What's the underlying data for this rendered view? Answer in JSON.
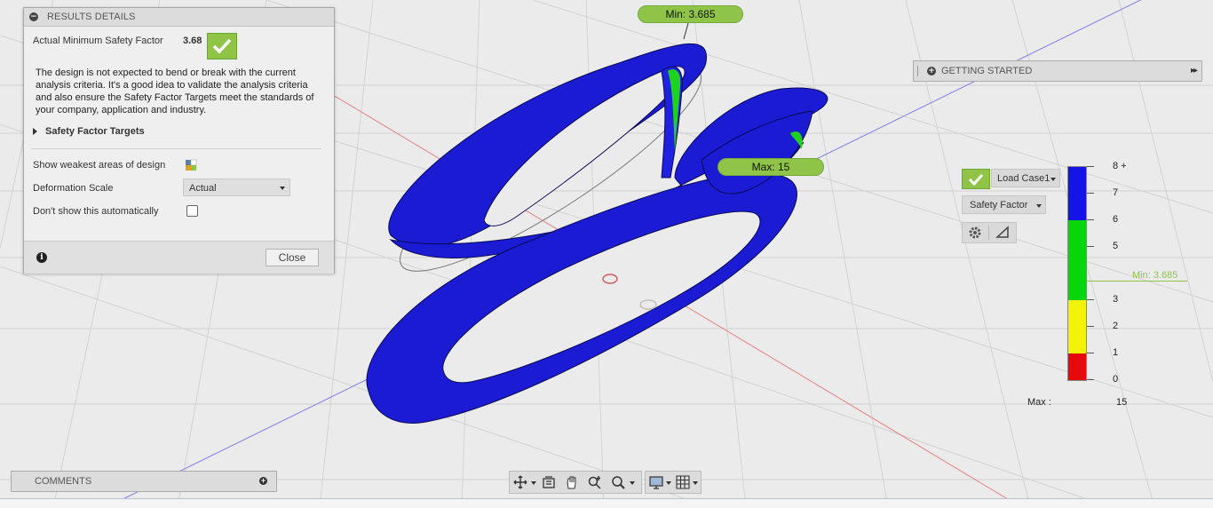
{
  "results_panel": {
    "title": "RESULTS DETAILS",
    "collapse_glyph": "−",
    "min_sf_label": "Actual Minimum Safety Factor",
    "min_sf_value": "3.68",
    "message": "The design is not expected to bend or break with the current analysis criteria. It's a good idea to validate the analysis criteria and also ensure the Safety Factor Targets meet the standards of your company, application and industry.",
    "safety_targets_label": "Safety Factor Targets",
    "show_weakest_label": "Show weakest areas of design",
    "deformation_label": "Deformation Scale",
    "deformation_value": "Actual",
    "dont_show_label": "Don't show this automatically",
    "info_glyph": "i",
    "close_label": "Close"
  },
  "getting_started": {
    "title": "GETTING STARTED",
    "plus_glyph": "+",
    "arrow_glyph": "▸▸"
  },
  "comments": {
    "title": "COMMENTS",
    "plus_glyph": "+"
  },
  "callouts": {
    "min": "Min: 3.685",
    "max": "Max: 15"
  },
  "legend": {
    "load_case": "Load Case1",
    "result_type": "Safety Factor",
    "ticks": [
      "8 +",
      "7",
      "6",
      "5",
      "3",
      "2",
      "1",
      "0"
    ],
    "min_marker": "Min: 3.685",
    "max_label": "Max :",
    "max_value": "15",
    "colors": {
      "blue": "#1414e6",
      "green": "#0ad40a",
      "yellow": "#f2f20a",
      "red": "#e60a0a"
    }
  },
  "icons": {
    "check": "check-icon",
    "gear": "gear-icon",
    "probe": "probe-icon",
    "orbit": "orbit-icon",
    "look_at": "look-at-icon",
    "pan": "pan-icon",
    "zoom": "zoom-icon",
    "zoom_window": "zoom-window-icon",
    "display": "display-settings-icon",
    "grid": "grid-settings-icon"
  },
  "colors": {
    "accent_green": "#8fc449",
    "model_blue": "#1414d0"
  }
}
